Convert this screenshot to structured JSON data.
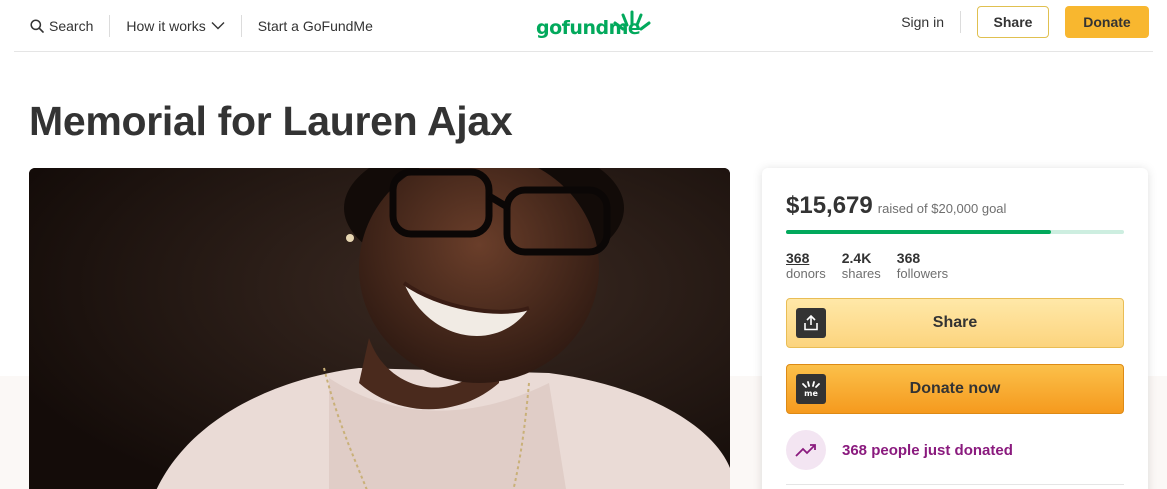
{
  "nav": {
    "search_label": "Search",
    "how_label": "How it works",
    "start_label": "Start a GoFundMe",
    "logo_text": "gofundme",
    "signin_label": "Sign in",
    "share_label": "Share",
    "donate_label": "Donate"
  },
  "campaign": {
    "title": "Memorial for Lauren Ajax"
  },
  "card": {
    "amount": "$15,679",
    "goal_text": "raised of $20,000 goal",
    "progress_fraction": 0.784,
    "stats": [
      {
        "value": "368",
        "label": "donors"
      },
      {
        "value": "2.4K",
        "label": "shares"
      },
      {
        "value": "368",
        "label": "followers"
      }
    ],
    "share_label": "Share",
    "donate_label": "Donate now",
    "recent_text": "368 people just donated"
  },
  "colors": {
    "brand_green": "#02a95c",
    "donate_yellow": "#f8b72f",
    "recent_purple": "#8a1a7e"
  },
  "icons": [
    "search-icon",
    "chevron-down-icon",
    "logo-burst-icon",
    "share-upload-icon",
    "gofundme-me-icon",
    "trending-up-icon"
  ]
}
